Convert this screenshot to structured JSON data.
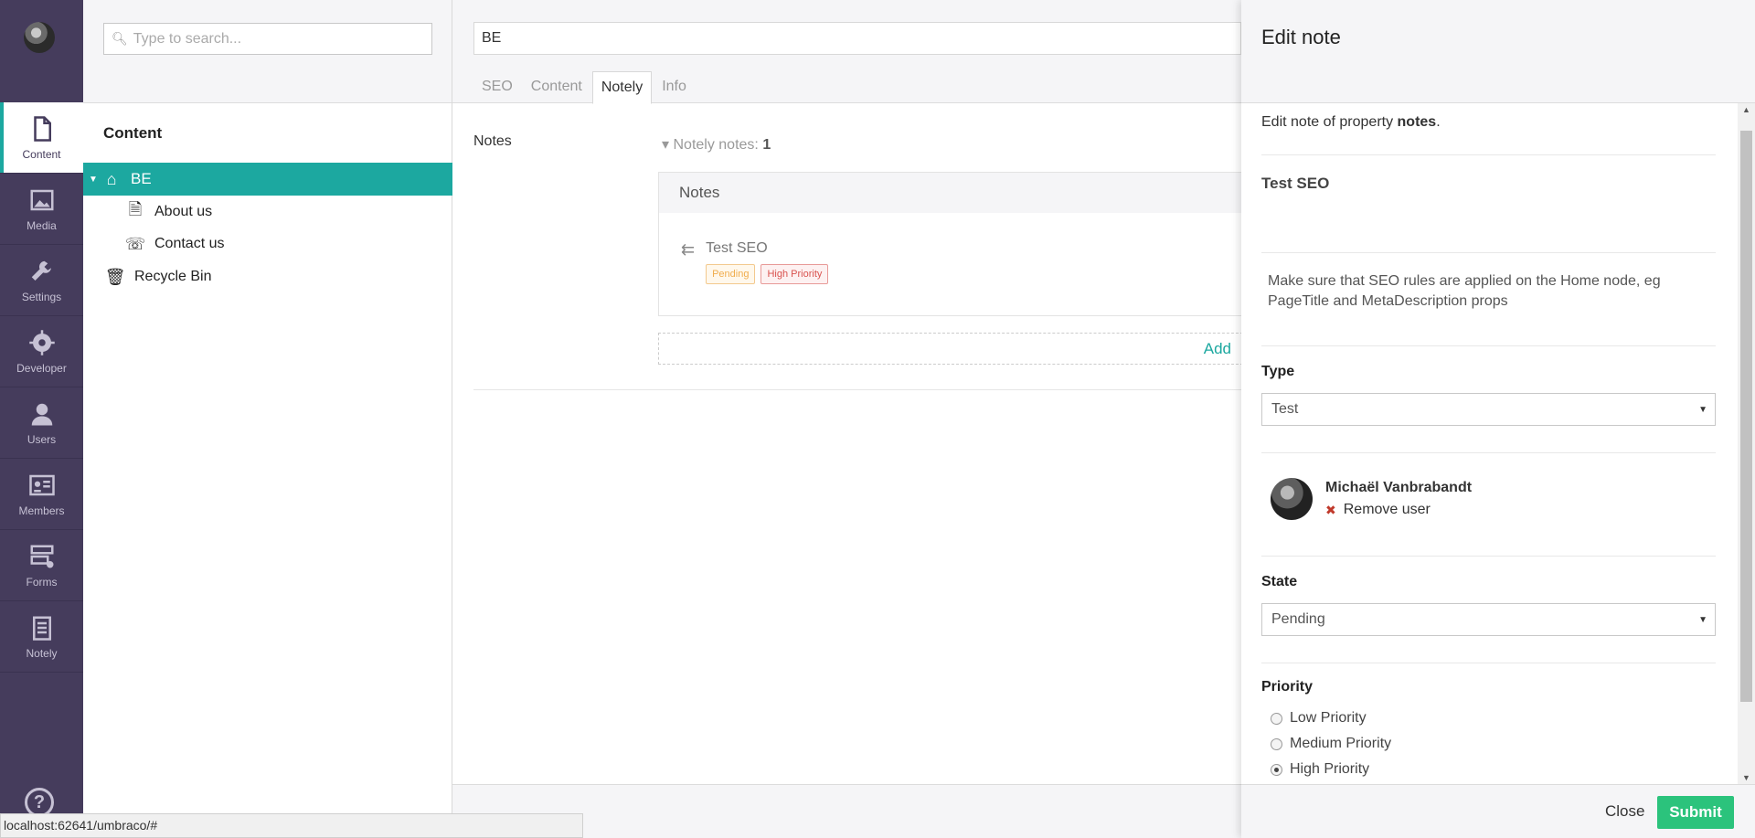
{
  "sections": [
    {
      "label": "Content",
      "icon": "document-icon",
      "active": true
    },
    {
      "label": "Media",
      "icon": "image-icon"
    },
    {
      "label": "Settings",
      "icon": "wrench-icon"
    },
    {
      "label": "Developer",
      "icon": "gear-icon"
    },
    {
      "label": "Users",
      "icon": "user-icon"
    },
    {
      "label": "Members",
      "icon": "id-card-icon"
    },
    {
      "label": "Forms",
      "icon": "forms-icon"
    },
    {
      "label": "Notely",
      "icon": "notepad-icon"
    }
  ],
  "tree": {
    "search_placeholder": "Type to search...",
    "title": "Content",
    "root": "BE",
    "children": [
      "About us",
      "Contact us"
    ],
    "recycle_bin": "Recycle Bin"
  },
  "editor": {
    "name_value": "BE",
    "tabs": [
      "SEO",
      "Content",
      "Notely",
      "Info"
    ],
    "active_tab": "Notely",
    "property_label": "Notes",
    "notes_toggle_label": "Notely notes:",
    "notes_count": "1",
    "notes_box_title": "Notes",
    "note_title": "Test SEO",
    "badges": {
      "pending": "Pending",
      "high": "High Priority"
    },
    "add_label": "Add"
  },
  "dialog": {
    "title": "Edit note",
    "intro_prefix": "Edit note of property ",
    "intro_property": "notes",
    "intro_suffix": ".",
    "note_title": "Test SEO",
    "description": "Make sure that SEO rules are applied on the Home node, eg PageTitle and MetaDescription props",
    "type_label": "Type",
    "type_value": "Test",
    "user_name": "Michaël Vanbrabandt",
    "remove_user": "Remove user",
    "state_label": "State",
    "state_value": "Pending",
    "priority_label": "Priority",
    "priorities": [
      "Low Priority",
      "Medium Priority",
      "High Priority"
    ],
    "selected_priority": "High Priority",
    "close_label": "Close",
    "submit_label": "Submit"
  },
  "status_url": "localhost:62641/umbraco/#",
  "colors": {
    "accent": "#1ca8a0",
    "appbar": "#453c5c",
    "submit": "#2bc37c"
  }
}
